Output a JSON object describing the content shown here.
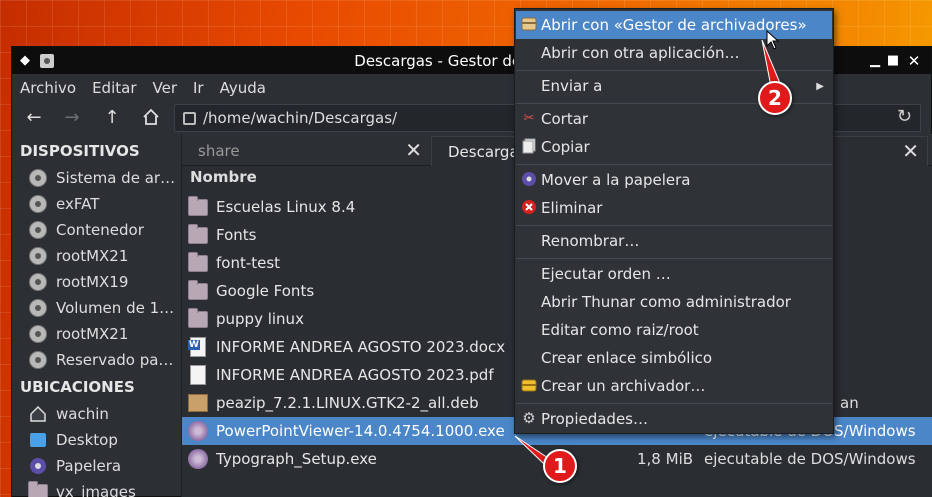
{
  "window": {
    "title": "Descargas - Gestor de archivos"
  },
  "menubar": [
    "Archivo",
    "Editar",
    "Ver",
    "Ir",
    "Ayuda"
  ],
  "pathbar": {
    "path": "/home/wachin/Descargas/"
  },
  "sidebar": {
    "devices_header": "DISPOSITIVOS",
    "devices": [
      "Sistema de ar…",
      "exFAT",
      "Contenedor",
      "rootMX21",
      "rootMX19",
      "Volumen de 1…",
      "rootMX21",
      "Reservado pa…"
    ],
    "places_header": "UBICACIONES",
    "places": [
      {
        "label": "wachin",
        "icon": "home-icon"
      },
      {
        "label": "Desktop",
        "icon": "desktop-icon"
      },
      {
        "label": "Papelera",
        "icon": "trash-icon"
      },
      {
        "label": "vx_images",
        "icon": "folder-icon"
      }
    ]
  },
  "tabs": [
    {
      "label": "share"
    },
    {
      "label": "Descargas"
    }
  ],
  "column_header": "Nombre",
  "files": [
    {
      "name": "Escuelas Linux 8.4",
      "icon": "folder-icon",
      "size": "",
      "type": ""
    },
    {
      "name": "Fonts",
      "icon": "folder-icon",
      "size": "",
      "type": ""
    },
    {
      "name": "font-test",
      "icon": "folder-icon",
      "size": "",
      "type": ""
    },
    {
      "name": "Google Fonts",
      "icon": "folder-icon",
      "size": "",
      "type": ""
    },
    {
      "name": "puppy linux",
      "icon": "folder-icon",
      "size": "",
      "type": ""
    },
    {
      "name": "INFORME ANDREA AGOSTO 2023.docx",
      "icon": "word-document-icon",
      "size": "",
      "type": ""
    },
    {
      "name": "INFORME ANDREA AGOSTO 2023.pdf",
      "icon": "pdf-document-icon",
      "size": "",
      "type": ""
    },
    {
      "name": "peazip_7.2.1.LINUX.GTK2-2_all.deb",
      "icon": "package-icon",
      "size": "",
      "type": "an"
    },
    {
      "name": "PowerPointViewer-14.0.4754.1000.exe",
      "icon": "exe-icon",
      "size": "",
      "type": "ejecutable de DOS/Windows",
      "selected": true
    },
    {
      "name": "Typograph_Setup.exe",
      "icon": "exe-icon",
      "size": "1,8 MiB",
      "type": "ejecutable de DOS/Windows"
    }
  ],
  "context_menu": {
    "items": [
      {
        "label": "Abrir con «Gestor de archivadores»",
        "icon": "archive-manager-icon",
        "highlighted": true
      },
      {
        "label": "Abrir con otra aplicación…",
        "icon": ""
      },
      {
        "label": "Enviar a",
        "icon": "",
        "submenu": true
      },
      {
        "label": "Cortar",
        "icon": "scissors-icon"
      },
      {
        "label": "Copiar",
        "icon": "copy-icon"
      },
      {
        "label": "Mover a la papelera",
        "icon": "trash-icon"
      },
      {
        "label": "Eliminar",
        "icon": "delete-icon"
      },
      {
        "label": "Renombrar…",
        "icon": ""
      },
      {
        "label": "Ejecutar orden …",
        "icon": ""
      },
      {
        "label": "Abrir Thunar como administrador",
        "icon": ""
      },
      {
        "label": "Editar como raiz/root",
        "icon": ""
      },
      {
        "label": "Crear enlace simbólico",
        "icon": ""
      },
      {
        "label": "Crear un archivador…",
        "icon": "archive-create-icon"
      },
      {
        "label": "Propiedades…",
        "icon": "gear-icon"
      }
    ]
  },
  "annotations": {
    "step1": "1",
    "step2": "2",
    "color": "#e0191a"
  }
}
